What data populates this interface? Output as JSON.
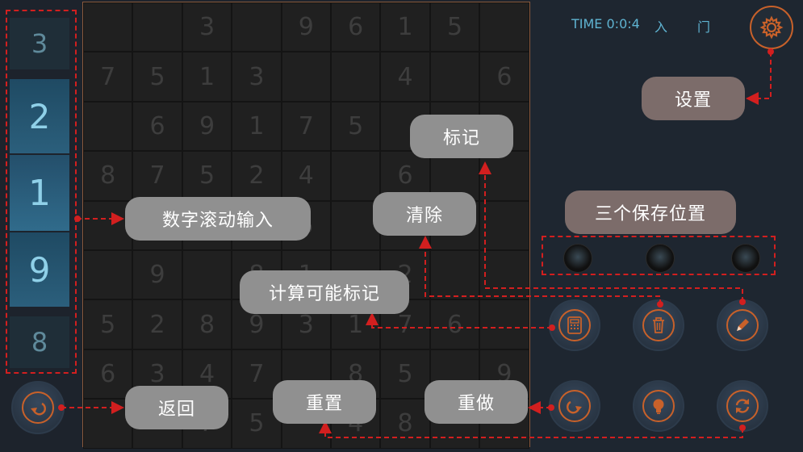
{
  "header": {
    "time_label": "TIME 0:0:4",
    "difficulty_1": "入",
    "difficulty_2": "门"
  },
  "number_scroll": [
    "3",
    "2",
    "1",
    "9",
    "8"
  ],
  "board_rows": [
    [
      "",
      "",
      "3",
      "",
      "9",
      "6",
      "1",
      "5",
      ""
    ],
    [
      "7",
      "5",
      "1",
      "3",
      "",
      "",
      "4",
      "",
      "6"
    ],
    [
      "",
      "6",
      "9",
      "1",
      "7",
      "5",
      "",
      "",
      "2"
    ],
    [
      "8",
      "7",
      "5",
      "2",
      "4",
      "",
      "6",
      "",
      ""
    ],
    [
      "",
      "",
      "",
      "",
      "5",
      "",
      "",
      "7",
      ""
    ],
    [
      "",
      "9",
      "",
      "8",
      "1",
      "",
      "2",
      "",
      ""
    ],
    [
      "5",
      "2",
      "8",
      "9",
      "3",
      "1",
      "7",
      "6",
      ""
    ],
    [
      "6",
      "3",
      "4",
      "7",
      "",
      "8",
      "5",
      "",
      "9"
    ],
    [
      "",
      "",
      "7",
      "5",
      "",
      "4",
      "8",
      "",
      ""
    ]
  ],
  "callouts": {
    "settings": "设置",
    "mark": "标记",
    "three_saves": "三个保存位置",
    "clear": "清除",
    "scroll_input": "数字滚动输入",
    "calc_marks": "计算可能标记",
    "back": "返回",
    "reset": "重置",
    "redo": "重做"
  },
  "icons": {
    "settings": "gear-icon",
    "back": "undo-arrow-icon",
    "calculator": "calculator-icon",
    "trash": "trash-icon",
    "pencil": "pencil-icon",
    "redo": "redo-arrow-icon",
    "hint": "lightbulb-icon",
    "reset": "refresh-icon"
  },
  "colors": {
    "accent": "#c8612a",
    "annotation": "#d21f1f",
    "time_text": "#5fb3d1"
  }
}
